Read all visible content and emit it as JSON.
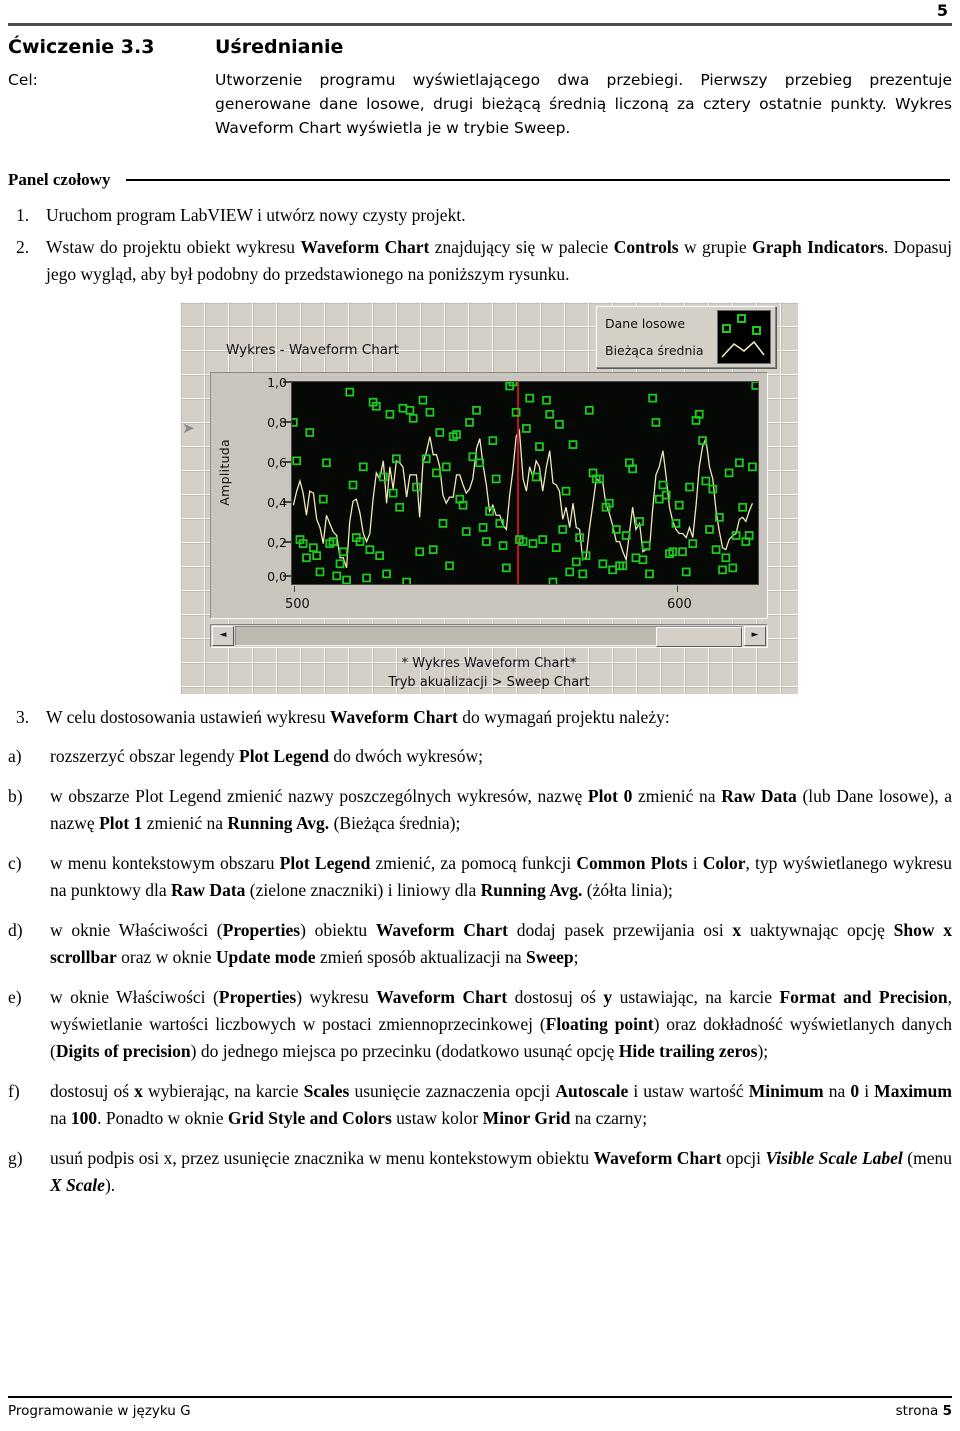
{
  "page": {
    "number_top": "5",
    "footer_left": "Programowanie w języku G",
    "footer_right_label": "strona",
    "footer_right_number": "5"
  },
  "exercise": {
    "number": "Ćwiczenie 3.3",
    "title": "Uśrednianie",
    "goal_label": "Cel:",
    "goal_text": "Utworzenie programu wyświetlającego dwa przebiegi. Pierwszy przebieg prezentuje generowane dane losowe, drugi bieżącą średnią liczoną za cztery ostatnie punkty. Wykres Waveform Chart wyświetla je w trybie Sweep."
  },
  "section": {
    "front_panel_heading": "Panel czołowy"
  },
  "steps": [
    {
      "marker": "1.",
      "html": "Uruchom program LabVIEW i utwórz nowy czysty projekt."
    },
    {
      "marker": "2.",
      "html": "Wstaw do projektu obiekt wykresu <b>Waveform Chart</b> znajdujący się w palecie <b>Controls</b> w grupie <b>Graph Indicators</b>. Dopasuj jego wygląd, aby był podobny do przedstawionego na poniższym rysunku."
    },
    {
      "marker": "3.",
      "html": "W celu dostosowania ustawień wykresu <b>Waveform Chart</b> do wymagań projektu należy:"
    }
  ],
  "substeps": [
    {
      "marker": "a)",
      "html": "rozszerzyć obszar legendy <b>Plot Legend</b> do dwóch wykresów;"
    },
    {
      "marker": "b)",
      "html": "w obszarze Plot Legend zmienić nazwy poszczególnych wykresów, nazwę <b>Plot 0</b> zmienić na <b>Raw Data</b> (lub Dane losowe), a nazwę <b>Plot 1</b> zmienić na <b>Running Avg.</b> (Bieżąca średnia);"
    },
    {
      "marker": "c)",
      "html": "w menu kontekstowym obszaru <b>Plot Legend</b> zmienić, za pomocą funkcji <b>Common Plots</b> i <b>Color</b>, typ wyświetlanego wykresu na punktowy dla <b>Raw Data</b> (zielone znaczniki) i liniowy dla <b>Running Avg.</b> (żółta linia);"
    },
    {
      "marker": "d)",
      "html": "w oknie Właściwości (<b>Properties</b>) obiektu <b>Waveform Chart</b> dodaj pasek przewijania osi <b>x</b> uaktywnając opcję <b>Show x scrollbar</b> oraz w oknie <b>Update mode</b> zmień sposób aktualizacji na <b>Sweep</b>;"
    },
    {
      "marker": "e)",
      "html": "w oknie Właściwości (<b>Properties</b>) wykresu <b>Waveform Chart</b> dostosuj oś <b>y</b> ustawiając, na karcie <b>Format and Precision</b>, wyświetlanie wartości liczbowych w postaci zmiennoprzecinkowej (<b>Floating point</b>) oraz dokładność wyświetlanych danych (<b>Digits of precision</b>) do jednego miejsca po przecinku (dodatkowo usunąć opcję <b>Hide trailing zeros</b>);"
    },
    {
      "marker": "f)",
      "html": "dostosuj oś <b>x</b> wybierając, na karcie <b>Scales</b> usunięcie zaznaczenia opcji <b>Autoscale</b> i ustaw wartość <b>Minimum</b> na <b>0</b> i <b>Maximum</b> na <b>100</b>. Ponadto w oknie <b>Grid Style and Colors</b> ustaw kolor <b>Minor Grid</b> na czarny;"
    },
    {
      "marker": "g)",
      "html": "usuń podpis osi x, przez usunięcie znacznika w menu kontekstowym obiektu <b>Waveform Chart</b> opcji <i><b>Visible Scale Label</b></i> (menu <i><b>X Scale</b></i>)."
    }
  ],
  "figure": {
    "chart_title": "Wykres - Waveform Chart",
    "legend": {
      "items": [
        {
          "label": "Dane losowe",
          "style": "point-markers",
          "color": "#1ec81e"
        },
        {
          "label": "Bieżąca średnia",
          "style": "line",
          "color": "#f0e8b8"
        }
      ]
    },
    "scroll": {
      "left_arrow": "◄",
      "right_arrow": "►"
    },
    "caption_line1": "* Wykres Waveform Chart*",
    "caption_line2": "Tryb akualizacji > Sweep Chart"
  },
  "chart_data": {
    "type": "scatter",
    "title": "Wykres - Waveform Chart",
    "xlabel": "",
    "ylabel": "Amplituda",
    "xlim": [
      500,
      600
    ],
    "ylim": [
      0.0,
      1.0
    ],
    "xticks": [
      "500",
      "600"
    ],
    "yticks": [
      "0,0",
      "0,2",
      "0,4",
      "0,6",
      "0,8",
      "1,0"
    ],
    "grid": false,
    "background": "#050805",
    "legend_position": "top-right",
    "sweep_cursor_x": 548.5,
    "sweep_cursor_color": "#c0131b",
    "series": [
      {
        "name": "Dane losowe",
        "type": "scatter",
        "marker": "open-square",
        "color": "#1ec81e",
        "x": [
          500.3,
          501.0,
          501.7,
          502.4,
          503.1,
          503.8,
          504.6,
          505.3,
          506.0,
          506.7,
          507.4,
          508.1,
          508.8,
          509.6,
          510.3,
          511.0,
          511.7,
          512.4,
          513.1,
          513.8,
          514.6,
          515.3,
          516.0,
          516.7,
          517.4,
          518.1,
          518.8,
          519.6,
          520.3,
          521.0,
          521.7,
          522.4,
          523.1,
          523.8,
          524.6,
          525.3,
          526.0,
          526.7,
          527.4,
          528.1,
          528.8,
          529.6,
          530.3,
          531.0,
          531.7,
          532.4,
          533.1,
          533.8,
          534.6,
          535.3,
          536.0,
          536.7,
          537.4,
          538.1,
          538.8,
          539.6,
          540.3,
          541.0,
          541.7,
          542.4,
          543.1,
          543.8,
          544.6,
          545.3,
          546.0,
          546.7,
          547.4,
          548.1,
          548.8,
          549.6,
          550.3,
          551.0,
          551.7,
          552.4,
          553.1,
          553.8,
          554.6,
          555.3,
          556.0,
          556.7,
          557.4,
          558.1,
          558.8,
          559.6,
          560.3,
          561.0,
          561.7,
          562.4,
          563.1,
          563.8,
          564.6,
          565.3,
          566.0,
          566.7,
          567.4,
          568.1,
          568.8,
          569.6,
          570.3,
          571.0,
          571.7,
          572.4,
          573.1,
          573.8,
          574.6,
          575.3,
          576.0,
          576.7,
          577.4,
          578.1,
          578.8,
          579.6,
          580.3,
          581.0,
          581.7,
          582.4,
          583.1,
          583.8,
          584.6,
          585.3,
          586.0,
          586.7,
          587.4,
          588.1,
          588.8,
          589.6,
          590.3,
          591.0,
          591.7,
          592.4,
          593.1,
          593.8,
          594.6,
          595.3,
          596.0,
          596.7,
          597.4,
          598.1,
          598.8,
          599.5
        ],
        "y": [
          0.8,
          0.61,
          0.22,
          0.2,
          0.13,
          0.75,
          0.18,
          0.14,
          0.06,
          0.42,
          0.6,
          0.2,
          0.21,
          0.04,
          0.1,
          0.16,
          0.02,
          0.95,
          0.49,
          0.23,
          0.21,
          0.58,
          0.03,
          0.17,
          0.9,
          0.88,
          0.14,
          0.53,
          0.05,
          0.84,
          0.45,
          0.62,
          0.38,
          0.87,
          0.01,
          0.86,
          0.82,
          0.48,
          0.16,
          0.91,
          0.62,
          0.85,
          0.17,
          0.55,
          0.75,
          0.3,
          0.58,
          0.09,
          0.73,
          0.74,
          0.42,
          0.39,
          0.26,
          0.8,
          0.63,
          0.86,
          0.6,
          0.28,
          0.21,
          0.36,
          0.71,
          0.52,
          0.3,
          0.19,
          0.08,
          0.98,
          1.0,
          0.85,
          0.22,
          0.21,
          0.77,
          0.92,
          0.2,
          0.53,
          0.68,
          0.22,
          0.91,
          0.84,
          0.01,
          0.18,
          0.79,
          0.27,
          0.46,
          0.06,
          0.69,
          0.11,
          0.23,
          0.05,
          0.14,
          0.86,
          0.55,
          0.52,
          0.52,
          0.1,
          0.38,
          0.4,
          0.07,
          0.27,
          0.09,
          0.09,
          0.24,
          0.6,
          0.57,
          0.13,
          0.31,
          0.12,
          0.19,
          0.05,
          0.92,
          0.8,
          0.42,
          0.49,
          0.44,
          0.15,
          0.16,
          0.3,
          0.39,
          0.16,
          0.06,
          0.48,
          0.2,
          0.81,
          0.84,
          0.71,
          0.51,
          0.27,
          0.47,
          0.17,
          0.33,
          0.07,
          0.13,
          0.55,
          0.08,
          0.24,
          0.6,
          0.38,
          0.21,
          0.24,
          0.58
        ]
      },
      {
        "name": "Bieżąca średnia",
        "type": "line",
        "color": "#f0e8b8",
        "x": [
          500.3,
          501.0,
          501.7,
          502.4,
          503.1,
          503.8,
          504.6,
          505.3,
          506.0,
          506.7,
          507.4,
          508.1,
          508.8,
          509.6,
          510.3,
          511.0,
          511.7,
          512.4,
          513.1,
          513.8,
          514.6,
          515.3,
          516.0,
          516.7,
          517.4,
          518.1,
          518.8,
          519.6,
          520.3,
          521.0,
          521.7,
          522.4,
          523.1,
          523.8,
          524.6,
          525.3,
          526.0,
          526.7,
          527.4,
          528.1,
          528.8,
          529.6,
          530.3,
          531.0,
          531.7,
          532.4,
          533.1,
          533.8,
          534.6,
          535.3,
          536.0,
          536.7,
          537.4,
          538.1,
          538.8,
          539.6,
          540.3,
          541.0,
          541.7,
          542.4,
          543.1,
          543.8,
          544.6,
          545.3,
          546.0,
          546.7,
          547.4,
          548.1,
          548.8,
          549.6,
          550.3,
          551.0,
          551.7,
          552.4,
          553.1,
          553.8,
          554.6,
          555.3,
          556.0,
          556.7,
          557.4,
          558.1,
          558.8,
          559.6,
          560.3,
          561.0,
          561.7,
          562.4,
          563.1,
          563.8,
          564.6,
          565.3,
          566.0,
          566.7,
          567.4,
          568.1,
          568.8,
          569.6,
          570.3,
          571.0,
          571.7,
          572.4,
          573.1,
          573.8,
          574.6,
          575.3,
          576.0,
          576.7,
          577.4,
          578.1,
          578.8,
          579.6,
          580.3,
          581.0,
          581.7,
          582.4,
          583.1,
          583.8,
          584.6,
          585.3,
          586.0,
          586.7,
          587.4,
          588.1,
          588.8,
          589.6,
          590.3,
          591.0,
          591.7,
          592.4,
          593.1,
          593.8,
          594.6,
          595.3,
          596.0,
          596.7,
          597.4,
          598.1,
          598.8,
          599.5
        ],
        "y": [
          0.39,
          0.46,
          0.51,
          0.45,
          0.34,
          0.46,
          0.45,
          0.32,
          0.28,
          0.2,
          0.34,
          0.3,
          0.26,
          0.24,
          0.13,
          0.13,
          0.08,
          0.31,
          0.41,
          0.42,
          0.35,
          0.25,
          0.21,
          0.25,
          0.42,
          0.55,
          0.52,
          0.61,
          0.4,
          0.58,
          0.47,
          0.61,
          0.6,
          0.58,
          0.43,
          0.54,
          0.54,
          0.54,
          0.33,
          0.6,
          0.65,
          0.73,
          0.64,
          0.64,
          0.58,
          0.44,
          0.4,
          0.43,
          0.43,
          0.54,
          0.54,
          0.49,
          0.45,
          0.47,
          0.52,
          0.67,
          0.72,
          0.59,
          0.49,
          0.36,
          0.39,
          0.34,
          0.34,
          0.29,
          0.27,
          0.44,
          0.56,
          0.73,
          0.76,
          0.52,
          0.46,
          0.58,
          0.53,
          0.61,
          0.58,
          0.46,
          0.58,
          0.66,
          0.5,
          0.49,
          0.46,
          0.32,
          0.38,
          0.28,
          0.4,
          0.28,
          0.27,
          0.12,
          0.13,
          0.27,
          0.4,
          0.52,
          0.51,
          0.5,
          0.39,
          0.35,
          0.29,
          0.21,
          0.21,
          0.16,
          0.12,
          0.25,
          0.38,
          0.27,
          0.3,
          0.16,
          0.17,
          0.17,
          0.37,
          0.54,
          0.58,
          0.66,
          0.53,
          0.38,
          0.31,
          0.27,
          0.25,
          0.25,
          0.23,
          0.28,
          0.23,
          0.39,
          0.58,
          0.68,
          0.72,
          0.58,
          0.52,
          0.36,
          0.26,
          0.18,
          0.17,
          0.22,
          0.24,
          0.25,
          0.32,
          0.33,
          0.31,
          0.36,
          0.4
        ]
      }
    ]
  }
}
